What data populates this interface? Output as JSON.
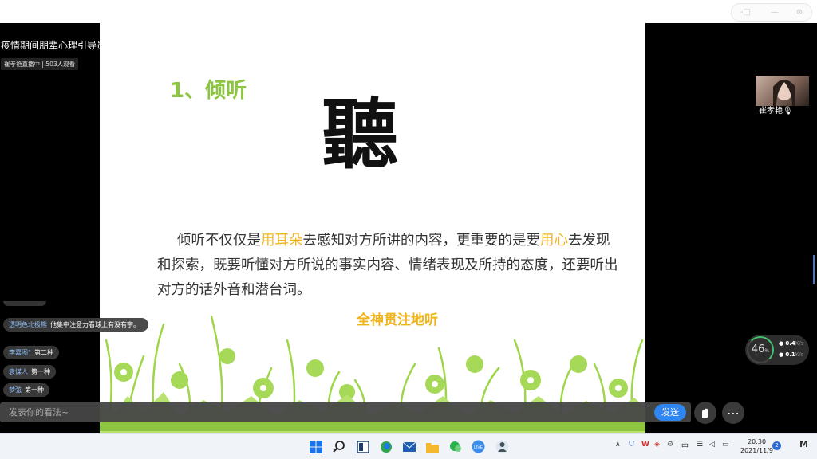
{
  "window": {
    "ctrl_left": "-□·",
    "ctrl_mid": "—",
    "ctrl_close": "⊗"
  },
  "stream": {
    "title": "疫情期间朋辈心理引导员",
    "host_status": "崔孝艳直播中 | 503人观看"
  },
  "slide": {
    "heading": "1、倾听",
    "character": "聽",
    "para_1": "倾听不仅仅是",
    "para_hl_1": "用耳朵",
    "para_2": "去感知对方所讲的内容，更重要的是要",
    "para_hl_2": "用心",
    "para_3": "去发现和探索，既要听懂对方所说的事实内容、情绪表现及所持的态度，还要听出对方的话外音和潜台词。",
    "tag": "全神贯注地听"
  },
  "camera": {
    "name": "崔孝艳",
    "mic_icon": "mic-icon"
  },
  "speed": {
    "percent": "46",
    "percent_unit": "%",
    "up": "0.4",
    "down": "0.1",
    "unit": "K/s"
  },
  "comments": [
    {
      "user": "透明色北极熊",
      "text": "他集中注意力看球上有没有字。"
    },
    {
      "user": "李嘉图°",
      "text": "第二种"
    },
    {
      "user": "袁谋人",
      "text": "第一种"
    },
    {
      "user": "梦弦",
      "text": "第一种"
    }
  ],
  "chat": {
    "placeholder": "发表你的看法~",
    "send": "发送"
  },
  "taskbar": {
    "time": "20:30",
    "date": "2021/11/9",
    "ime": "中",
    "notifications": "2",
    "live_label": "LIVE"
  },
  "colors": {
    "accent_green": "#8cc63f",
    "highlight_yellow": "#f2b51b",
    "send_blue": "#2f86f0"
  }
}
